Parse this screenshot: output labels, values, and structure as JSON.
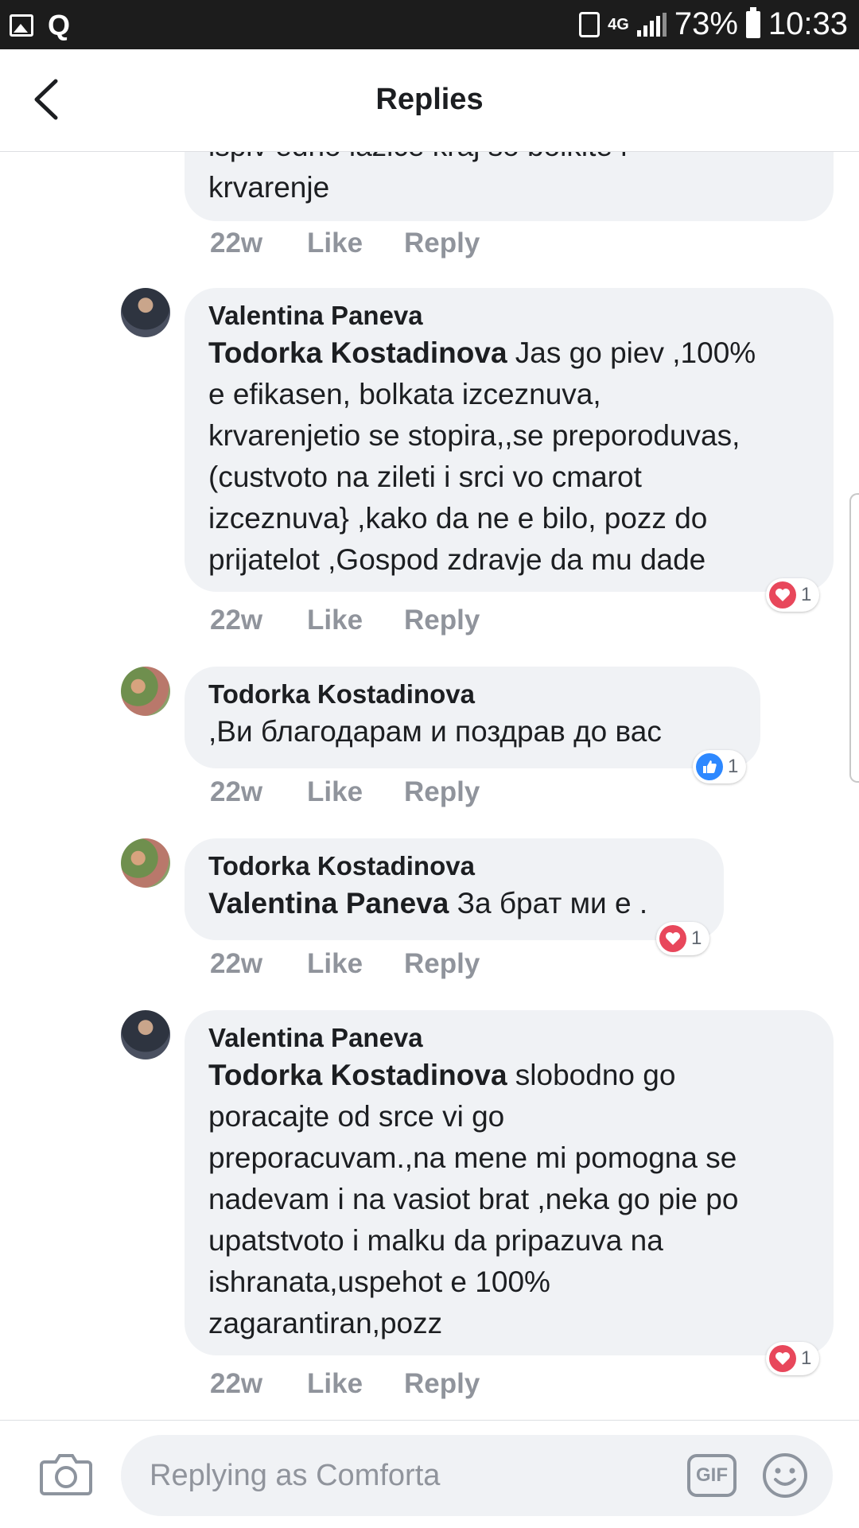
{
  "status_bar": {
    "network": "4G",
    "battery": "73%",
    "time": "10:33"
  },
  "header": {
    "title": "Replies"
  },
  "comments": [
    {
      "partial_line1": "ispiv edno lazice kraj so bolkite i",
      "partial_line2": "krvarenje",
      "time": "22w",
      "like": "Like",
      "reply": "Reply"
    },
    {
      "author": "Valentina Paneva",
      "mention": "Todorka Kostadinova",
      "lines": [
        " Jas go piev ,100%",
        "e efikasen, bolkata izceznuva,",
        "krvarenjetio se stopira,,se preporoduvas,",
        "(custvoto na zileti i srci vo cmarot",
        "izceznuva} ,kako da ne e bilo,  pozz do",
        "prijatelot ,Gospod zdravje da mu dade"
      ],
      "time": "22w",
      "like": "Like",
      "reply": "Reply",
      "reaction": {
        "type": "heart",
        "count": "1"
      }
    },
    {
      "author": "Todorka Kostadinova",
      "text": ",Ви благодарам и поздрав до вас",
      "time": "22w",
      "like": "Like",
      "reply": "Reply",
      "reaction": {
        "type": "like",
        "count": "1"
      }
    },
    {
      "author": "Todorka Kostadinova",
      "mention": "Valentina Paneva",
      "text": " За брат ми е .",
      "time": "22w",
      "like": "Like",
      "reply": "Reply",
      "reaction": {
        "type": "heart",
        "count": "1"
      }
    },
    {
      "author": "Valentina Paneva",
      "mention": "Todorka Kostadinova",
      "lines": [
        " slobodno go",
        "poracajte od srce vi go",
        "preporacuvam.,na mene mi pomogna se",
        "nadevam i na vasiot brat ,neka go pie po",
        "upatstvoto i malku da pripazuva na",
        "ishranata,uspehot e 100%",
        "zagarantiran,pozz"
      ],
      "time": "22w",
      "like": "Like",
      "reply": "Reply",
      "reaction": {
        "type": "heart",
        "count": "1"
      }
    }
  ],
  "composer": {
    "placeholder": "Replying as Comforta",
    "gif_label": "GIF"
  },
  "colors": {
    "bubble": "#f0f2f5",
    "meta": "#90949c",
    "heart": "#e8475b",
    "like": "#2d88ff"
  }
}
